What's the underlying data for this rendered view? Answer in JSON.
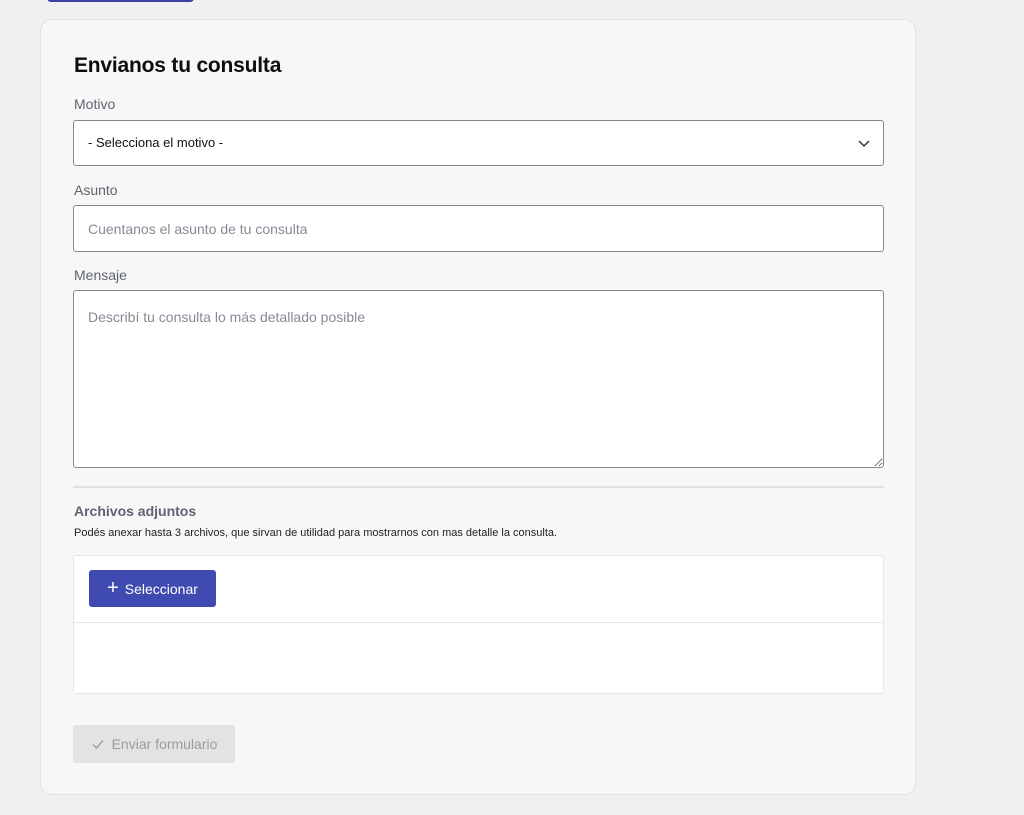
{
  "form": {
    "title": "Envianos tu consulta",
    "motivo_label": "Motivo",
    "motivo_selected": "- Selecciona el motivo -",
    "asunto_label": "Asunto",
    "asunto_placeholder": "Cuentanos el asunto de tu consulta",
    "mensaje_label": "Mensaje",
    "mensaje_placeholder": "Describí tu consulta lo más detallado posible"
  },
  "attachments": {
    "title": "Archivos adjuntos",
    "description": "Podés anexar hasta 3 archivos, que sirvan de utilidad para mostrarnos con mas detalle la consulta.",
    "select_button_label": "Seleccionar",
    "select_icon": "plus-icon"
  },
  "submit": {
    "label": "Enviar formulario",
    "icon": "check-icon",
    "disabled": true
  },
  "colors": {
    "accent": "#3f4bb0",
    "background": "#f1efef",
    "card": "#f7f7f7",
    "disabled_button": "#e3e3e3"
  }
}
